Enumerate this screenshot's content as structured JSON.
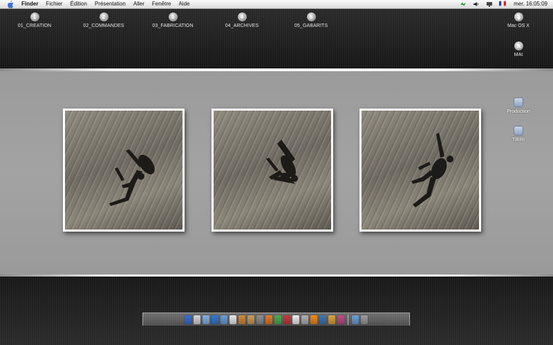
{
  "menubar": {
    "apple_icon": "apple-icon",
    "items": [
      {
        "label": "Finder",
        "bold": true
      },
      {
        "label": "Fichier"
      },
      {
        "label": "Édition"
      },
      {
        "label": "Présentation"
      },
      {
        "label": "Aller"
      },
      {
        "label": "Fenêtre"
      },
      {
        "label": "Aide"
      }
    ],
    "status_icons": [
      "sync-icon",
      "volume-icon",
      "display-icon",
      "flag-fr-icon"
    ],
    "clock": "mer. 16:05:09"
  },
  "desktop": {
    "folders": [
      {
        "number": "1",
        "label": "01_CREATION"
      },
      {
        "number": "2",
        "label": "02_COMMANDES"
      },
      {
        "number": "3",
        "label": "03_FABRICATION"
      },
      {
        "number": "4",
        "label": "04_ARCHIVES"
      },
      {
        "number": "5",
        "label": "05_GABARITS"
      }
    ],
    "volumes": [
      {
        "label": "Mac OS X",
        "icon": "download-icon"
      },
      {
        "label": "MAt",
        "icon": "close-icon"
      }
    ],
    "servers": [
      {
        "label": "Production",
        "icon": "server-icon"
      },
      {
        "label": "TIERI",
        "icon": "server-icon"
      }
    ]
  },
  "photos": [
    {
      "name": "climber-photo-1"
    },
    {
      "name": "climber-photo-2"
    },
    {
      "name": "climber-photo-3"
    }
  ],
  "dock": {
    "items": [
      "finder-icon",
      "dashboard-icon",
      "mail-icon",
      "safari-icon",
      "itunes-icon",
      "ical-icon",
      "preview-icon",
      "address-book-icon",
      "system-preferences-icon",
      "firefox-icon",
      "adium-icon",
      "pdf-icon",
      "text-edit-icon",
      "automator-icon",
      "vlc-icon",
      "photoshop-icon",
      "illustrator-icon",
      "indesign-icon",
      "quark-icon",
      "trash-icon"
    ],
    "colors": [
      "#3a6fd1",
      "#d6d6d6",
      "#7fb3e6",
      "#2f79d6",
      "#6b9ed7",
      "#e8e8e8",
      "#d08a3a",
      "#c99a5e",
      "#8e8e8e",
      "#e07b2a",
      "#4cae4c",
      "#c93a3a",
      "#ededed",
      "#b0b0b0",
      "#f08a1c",
      "#3d76b8",
      "#d9a23a",
      "#c64a86",
      "#6f9fd3",
      "#9a9a9a"
    ]
  }
}
